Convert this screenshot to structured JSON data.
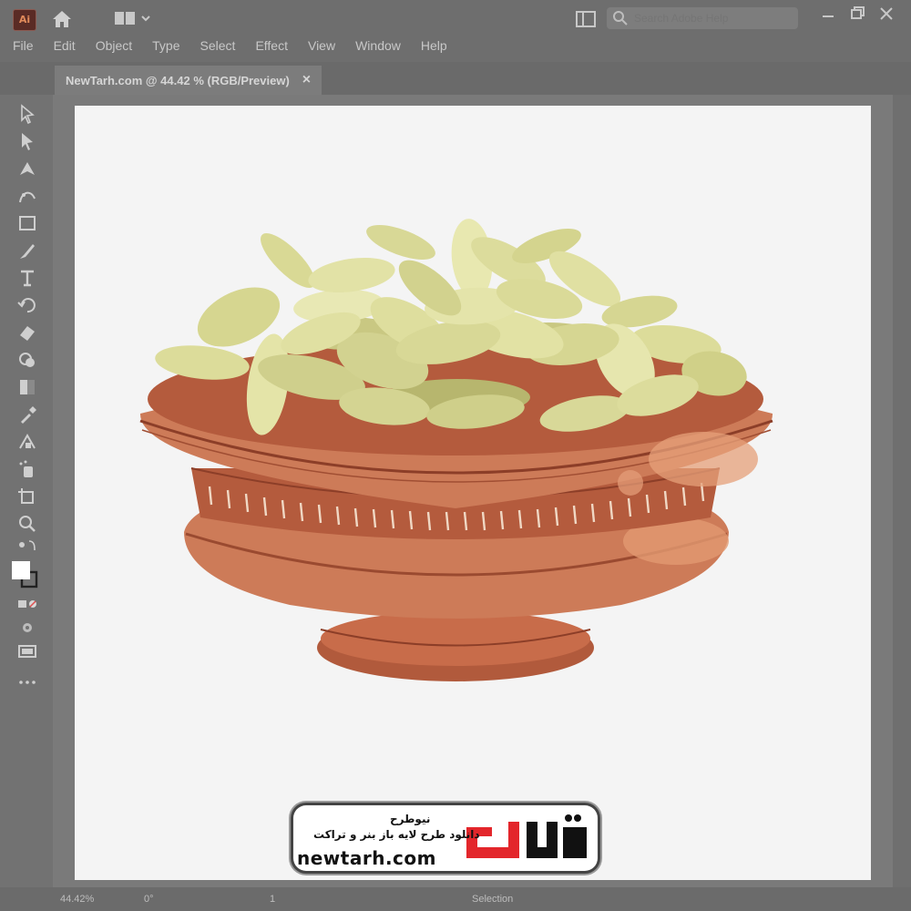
{
  "app": {
    "logo_text": "Ai"
  },
  "menu": {
    "items": [
      "File",
      "Edit",
      "Object",
      "Type",
      "Select",
      "Effect",
      "View",
      "Window",
      "Help"
    ]
  },
  "search": {
    "placeholder": "Search Adobe Help"
  },
  "document": {
    "tab_label": "NewTarh.com @ 44.42 % (RGB/Preview)",
    "close_label": "×"
  },
  "status": {
    "zoom": "44.42%",
    "rotation": "0°",
    "artboard_index": "1",
    "mode": "Selection"
  },
  "watermark": {
    "brand_url": "newtarh.com",
    "brand_name_fa": "نیوطرح",
    "tagline_fa": "دانلود طرح لایه باز بنر و تراکت"
  },
  "colors": {
    "bowl": "#d2825d",
    "bowl_dark": "#b45c3c",
    "seeds": "#dcdc9a",
    "logo_red": "#e3262b"
  }
}
